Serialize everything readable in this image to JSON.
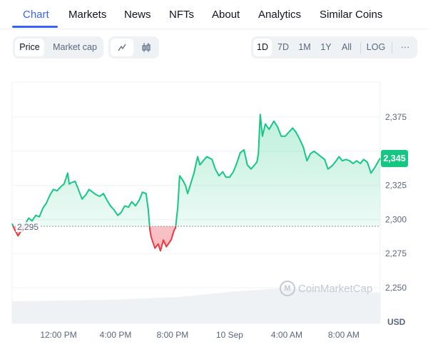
{
  "tabs": [
    {
      "label": "Chart",
      "active": true
    },
    {
      "label": "Markets"
    },
    {
      "label": "News"
    },
    {
      "label": "NFTs"
    },
    {
      "label": "About"
    },
    {
      "label": "Analytics"
    },
    {
      "label": "Similar Coins"
    }
  ],
  "toolbar": {
    "metric_toggle": [
      {
        "label": "Price",
        "active": true
      },
      {
        "label": "Market cap"
      }
    ],
    "chart_type_toggle": [
      {
        "icon": "line-chart-icon",
        "active": true
      },
      {
        "icon": "candlestick-icon"
      }
    ],
    "ranges": [
      {
        "label": "1D",
        "active": true
      },
      {
        "label": "7D"
      },
      {
        "label": "1M"
      },
      {
        "label": "1Y"
      },
      {
        "label": "All"
      }
    ],
    "log_label": "LOG",
    "more_label": "···"
  },
  "watermark": {
    "text": "CoinMarketCap",
    "icon": "coinmarketcap-logo-icon"
  },
  "current_price_badge": "2,345",
  "reference_price_label": "2,295",
  "colors": {
    "accent": "#3861fb",
    "up": "#16c784",
    "down": "#ea3943",
    "volume": "#eff2f5"
  },
  "chart_data": {
    "type": "area",
    "title": "",
    "currency_label": "USD",
    "reference_price": 2295,
    "current_price": 2345,
    "ylim": [
      2230,
      2385
    ],
    "yticks": [
      2375,
      2350,
      2325,
      2300,
      2275,
      2250
    ],
    "ytick_labels": [
      "2,375",
      "",
      "2,325",
      "2,300",
      "2,275",
      "2,250"
    ],
    "xtick_labels": [
      "12:00 PM",
      "4:00 PM",
      "8:00 PM",
      "10 Sep",
      "4:00 AM",
      "8:00 AM"
    ],
    "xtick_positions": [
      0.126,
      0.281,
      0.436,
      0.591,
      0.746,
      0.901
    ],
    "grid": true,
    "legend": "none",
    "series": [
      {
        "name": "Price",
        "x": [
          0,
          0.006,
          0.016,
          0.025,
          0.045,
          0.054,
          0.064,
          0.074,
          0.083,
          0.093,
          0.103,
          0.112,
          0.122,
          0.132,
          0.141,
          0.151,
          0.155,
          0.161,
          0.171,
          0.18,
          0.19,
          0.2,
          0.209,
          0.219,
          0.229,
          0.238,
          0.248,
          0.258,
          0.267,
          0.277,
          0.287,
          0.296,
          0.306,
          0.316,
          0.325,
          0.335,
          0.345,
          0.354,
          0.364,
          0.37,
          0.374,
          0.378,
          0.388,
          0.397,
          0.403,
          0.411,
          0.419,
          0.432,
          0.44,
          0.444,
          0.45,
          0.455,
          0.463,
          0.471,
          0.477,
          0.494,
          0.504,
          0.51,
          0.519,
          0.529,
          0.543,
          0.552,
          0.562,
          0.572,
          0.581,
          0.591,
          0.601,
          0.61,
          0.62,
          0.63,
          0.639,
          0.649,
          0.659,
          0.665,
          0.669,
          0.674,
          0.68,
          0.688,
          0.698,
          0.711,
          0.721,
          0.731,
          0.742,
          0.752,
          0.762,
          0.771,
          0.781,
          0.791,
          0.801,
          0.81,
          0.82,
          0.83,
          0.839,
          0.849,
          0.858,
          0.868,
          0.878,
          0.888,
          0.897,
          0.907,
          0.917,
          0.926,
          0.936,
          0.946,
          0.955,
          0.965,
          0.975,
          0.985,
          1.0
        ],
        "values": [
          2297,
          2293,
          2288,
          2292,
          2301,
          2299,
          2303,
          2302,
          2308,
          2312,
          2318,
          2322,
          2321,
          2324,
          2326,
          2334,
          2326,
          2327,
          2328,
          2322,
          2315,
          2318,
          2322,
          2320,
          2318,
          2317,
          2319,
          2314,
          2310,
          2307,
          2303,
          2305,
          2310,
          2309,
          2313,
          2310,
          2314,
          2320,
          2319,
          2307,
          2293,
          2287,
          2279,
          2282,
          2277,
          2285,
          2280,
          2285,
          2292,
          2294,
          2309,
          2332,
          2329,
          2325,
          2319,
          2334,
          2346,
          2340,
          2343,
          2346,
          2344,
          2337,
          2332,
          2335,
          2331,
          2331,
          2335,
          2341,
          2349,
          2351,
          2340,
          2337,
          2340,
          2342,
          2348,
          2377,
          2361,
          2370,
          2366,
          2372,
          2368,
          2361,
          2361,
          2364,
          2367,
          2364,
          2359,
          2353,
          2343,
          2348,
          2350,
          2348,
          2346,
          2344,
          2337,
          2339,
          2342,
          2346,
          2343,
          2344,
          2343,
          2341,
          2343,
          2341,
          2344,
          2342,
          2334,
          2338,
          2345
        ]
      }
    ]
  }
}
